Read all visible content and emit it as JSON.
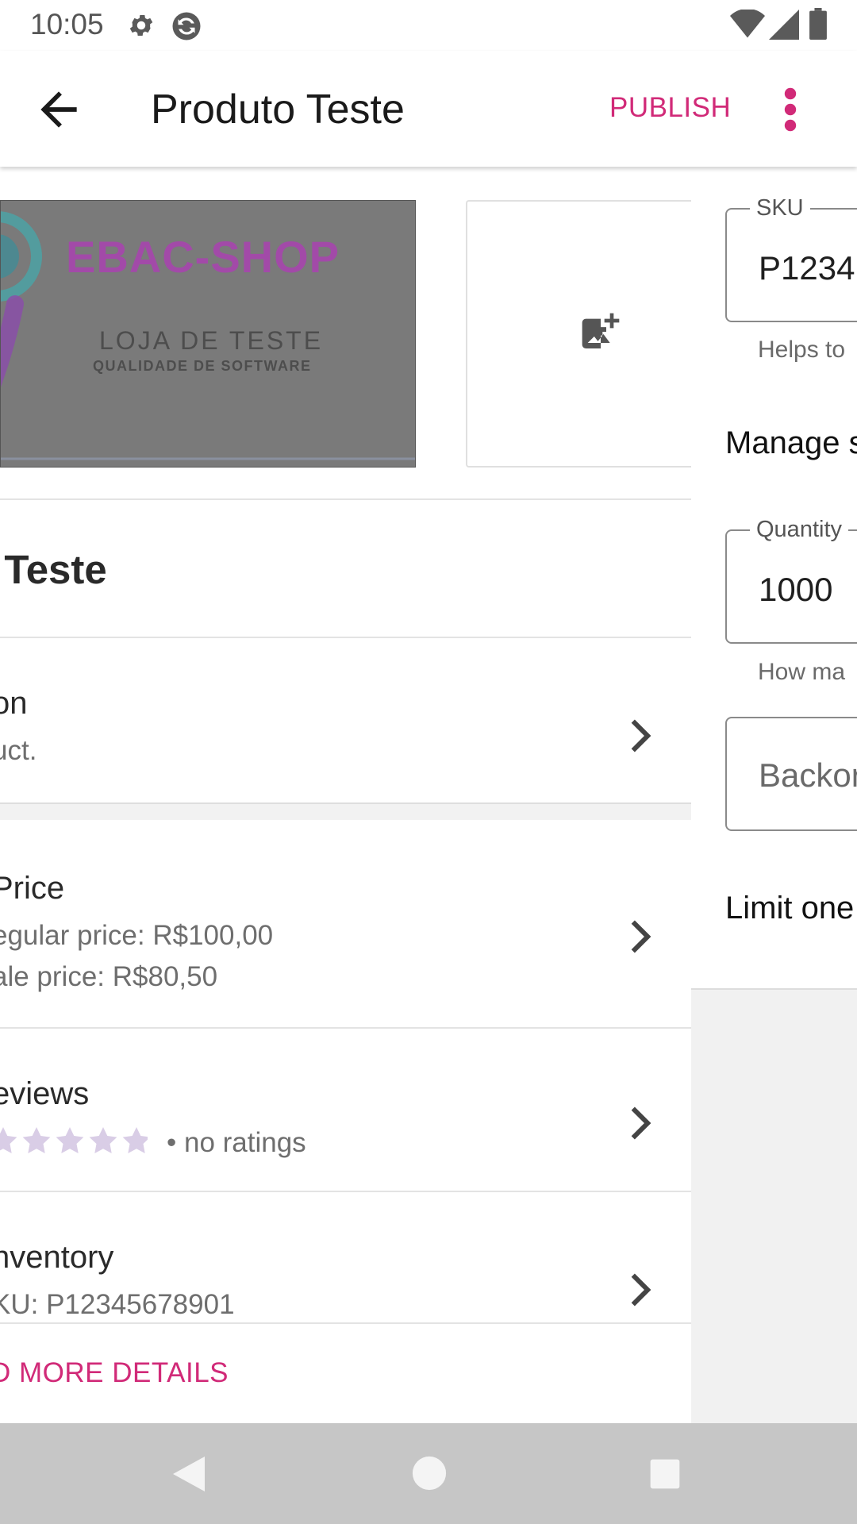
{
  "status_bar": {
    "time": "10:05",
    "icons": [
      "gear-icon",
      "sync-icon",
      "wifi-icon",
      "signal-icon",
      "battery-icon"
    ]
  },
  "app_bar": {
    "back_icon": "arrow-back-icon",
    "title": "Produto Teste",
    "publish_label": "PUBLISH",
    "overflow_icon": "more-vert-icon"
  },
  "images": {
    "product_image_brand": "EBAC-SHOP",
    "product_image_line1": "LOJA DE TESTE",
    "product_image_line2": "QUALIDADE DE SOFTWARE",
    "add_image_icon": "add-photo-icon"
  },
  "product": {
    "name": "o Teste"
  },
  "rows": {
    "description": {
      "title": "on",
      "subtitle": "uct."
    },
    "price": {
      "title": "Price",
      "regular": "egular price: R$100,00",
      "sale": "ale price: R$80,50"
    },
    "reviews": {
      "title": "eviews",
      "rating_text": "• no ratings",
      "stars": 0
    },
    "inventory": {
      "title": "nventory",
      "sku": "KU: P12345678901"
    }
  },
  "add_more_label": "D MORE DETAILS",
  "inventory_panel": {
    "sku_label": "SKU",
    "sku_value": "P1234",
    "sku_helper": "Helps to",
    "manage_stock": "Manage s",
    "quantity_label": "Quantity",
    "quantity_value": "1000",
    "quantity_helper": "How ma",
    "backorders_placeholder": "Backor",
    "limit_one": "Limit one"
  },
  "colors": {
    "accent": "#d12a78",
    "star": "#d9cde6",
    "image_overlay": "#7a7a7a",
    "nav_bar": "#c6c6c6"
  }
}
